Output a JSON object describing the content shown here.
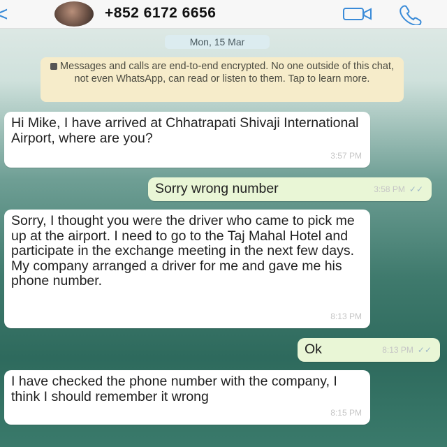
{
  "header": {
    "back_glyph": "<",
    "contact": "+852 6172 6656",
    "icons": [
      "back-arrow-icon",
      "video-call-icon",
      "phone-icon"
    ]
  },
  "chat": {
    "date": "Mon, 15 Mar",
    "encryption_notice": "Messages and calls are end-to-end encrypted. No one outside of this chat, not even WhatsApp, can read or listen to them. Tap to learn more.",
    "messages": [
      {
        "dir": "in",
        "text": "Hi Mike, I have arrived at Chhatrapati Shivaji International Airport, where are you?",
        "time": "3:57 PM"
      },
      {
        "dir": "out",
        "text": "Sorry wrong number",
        "time": "3:58 PM"
      },
      {
        "dir": "in",
        "text": "Sorry, I thought you were the driver who came to pick me up at the airport. I need to go to the Taj Mahal Hotel and participate in the exchange meeting in the next few days. My company arranged a driver for me and gave me his phone number.",
        "time": "8:13 PM"
      },
      {
        "dir": "out",
        "text": "Ok",
        "time": "8:13 PM"
      },
      {
        "dir": "in",
        "text": "I have checked the phone number with the company, I think I should remember it wrong",
        "time": "8:15 PM"
      }
    ]
  },
  "colors": {
    "incoming_bubble": "#ffffff",
    "outgoing_bubble": "#e9f6d6",
    "encryption_bg": "#f6ecca",
    "accent": "#3a8bd8"
  }
}
